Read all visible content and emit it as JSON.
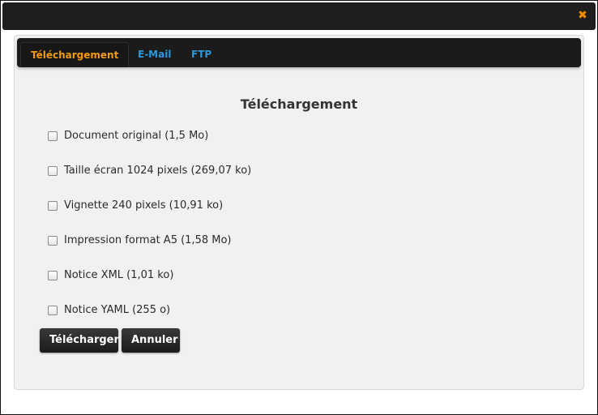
{
  "window": {
    "close_icon": "close-icon",
    "close_glyph": "✖"
  },
  "tabs": [
    {
      "label": "Téléchargement",
      "active": true
    },
    {
      "label": "E-Mail",
      "active": false
    },
    {
      "label": "FTP",
      "active": false
    }
  ],
  "section": {
    "title": "Téléchargement"
  },
  "options": [
    {
      "label": "Document original (1,5 Mo)",
      "checked": false
    },
    {
      "label": "Taille écran 1024 pixels (269,07 ko)",
      "checked": false
    },
    {
      "label": "Vignette 240 pixels (10,91 ko)",
      "checked": false
    },
    {
      "label": "Impression format A5 (1,58 Mo)",
      "checked": false
    },
    {
      "label": "Notice XML (1,01 ko)",
      "checked": false
    },
    {
      "label": "Notice YAML (255 o)",
      "checked": false
    }
  ],
  "buttons": {
    "download": "Télécharger",
    "cancel": "Annuler"
  },
  "colors": {
    "accent": "#f59a10",
    "link": "#2d96d6",
    "dark": "#1b1b1b"
  }
}
